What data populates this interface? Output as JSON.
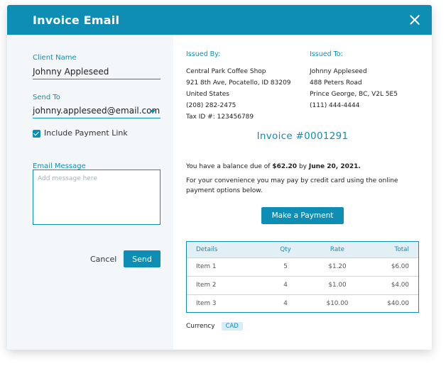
{
  "window": {
    "title": "Invoice Email"
  },
  "form": {
    "client_name_label": "Client Name",
    "client_name_value": "Johnny Appleseed",
    "send_to_label": "Send To",
    "send_to_value": "johnny.appleseed@email.com",
    "include_link_label": "Include Payment Link",
    "include_link_checked": true,
    "email_message_label": "Email Message",
    "email_message_placeholder": "Add message here",
    "cancel_label": "Cancel",
    "send_label": "Send"
  },
  "invoice": {
    "issued_by": {
      "heading": "Issued By:",
      "lines": [
        "Central Park Coffee Shop",
        "921 8th Ave, Pocatello, ID 83209",
        "United States",
        "(208) 282-2475",
        "Tax ID #: 123456789"
      ]
    },
    "issued_to": {
      "heading": "Issued To:",
      "lines": [
        "Johnny Appleseed",
        "488 Peters Road",
        "Prince George, BC, V2L 5E5",
        "(111) 444-4444"
      ]
    },
    "number": "Invoice #0001291",
    "balance_prefix": "You have a balance due of ",
    "balance_amount": "$62.20",
    "balance_by": " by ",
    "due_date": "June 20, 2021.",
    "convenience_text": "For your convenience you may pay by credit card using the online payment options below.",
    "pay_button": "Make a Payment",
    "table": {
      "headers": [
        "Details",
        "Qty",
        "Rate",
        "Total"
      ],
      "rows": [
        [
          "Item 1",
          "5",
          "$1.20",
          "$6.00"
        ],
        [
          "Item 2",
          "4",
          "$1.00",
          "$4.00"
        ],
        [
          "Item 3",
          "4",
          "$10.00",
          "$40.00"
        ]
      ]
    },
    "currency_label": "Currency",
    "currency_value": "CAD"
  },
  "colors": {
    "accent": "#0e8eb4",
    "panel_bg": "#f3f7fa",
    "header_row": "#e2eff5"
  }
}
